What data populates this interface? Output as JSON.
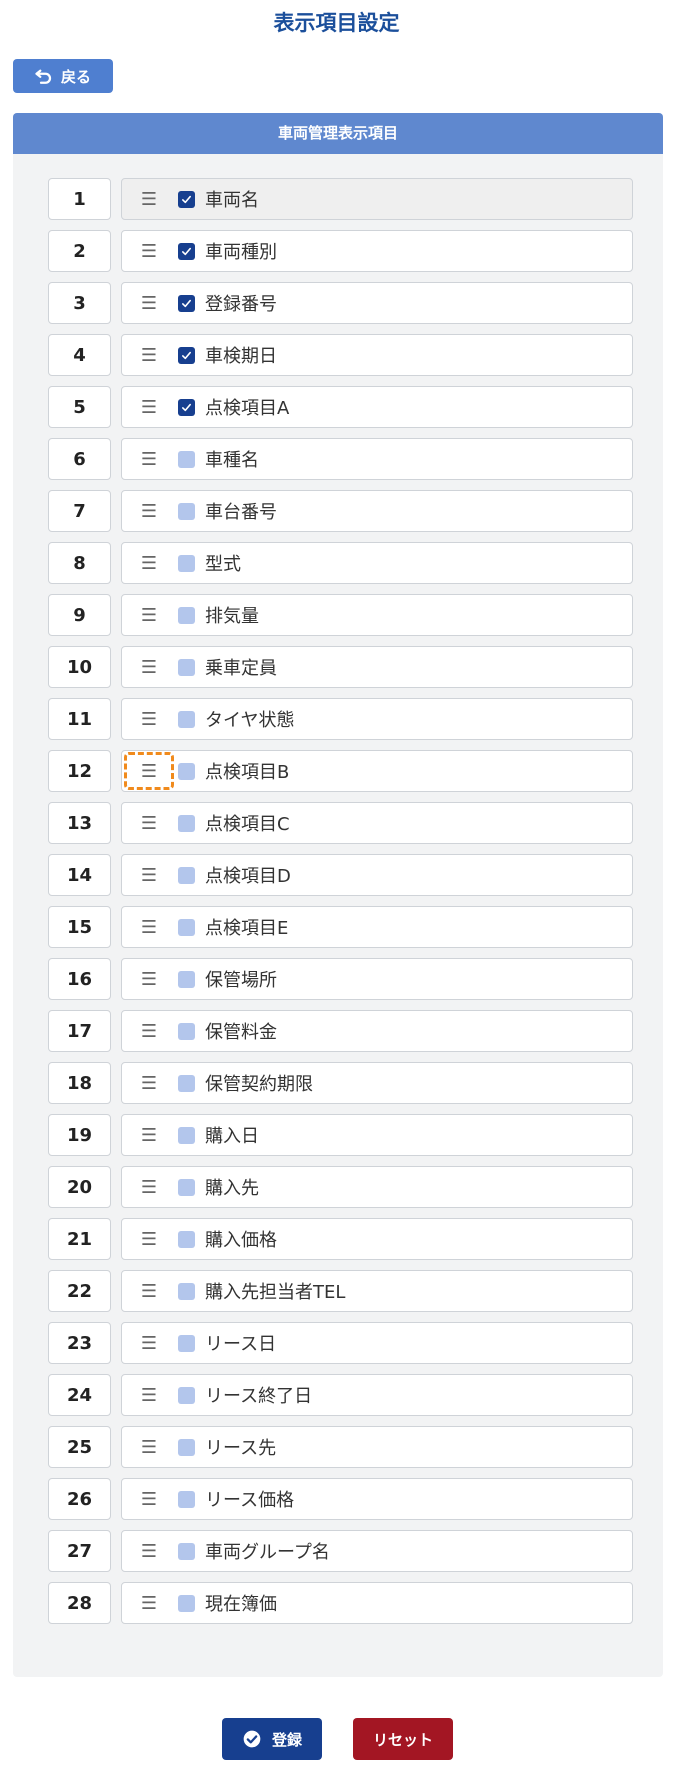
{
  "page": {
    "title": "表示項目設定"
  },
  "toolbar": {
    "back_label": "戻る"
  },
  "panel": {
    "title": "車両管理表示項目",
    "items": [
      {
        "number": "1",
        "label": "車両名",
        "checked": true
      },
      {
        "number": "2",
        "label": "車両種別",
        "checked": true
      },
      {
        "number": "3",
        "label": "登録番号",
        "checked": true
      },
      {
        "number": "4",
        "label": "車検期日",
        "checked": true
      },
      {
        "number": "5",
        "label": "点検項目A",
        "checked": true
      },
      {
        "number": "6",
        "label": "車種名",
        "checked": false
      },
      {
        "number": "7",
        "label": "車台番号",
        "checked": false
      },
      {
        "number": "8",
        "label": "型式",
        "checked": false
      },
      {
        "number": "9",
        "label": "排気量",
        "checked": false
      },
      {
        "number": "10",
        "label": "乗車定員",
        "checked": false
      },
      {
        "number": "11",
        "label": "タイヤ状態",
        "checked": false
      },
      {
        "number": "12",
        "label": "点検項目B",
        "checked": false
      },
      {
        "number": "13",
        "label": "点検項目C",
        "checked": false
      },
      {
        "number": "14",
        "label": "点検項目D",
        "checked": false
      },
      {
        "number": "15",
        "label": "点検項目E",
        "checked": false
      },
      {
        "number": "16",
        "label": "保管場所",
        "checked": false
      },
      {
        "number": "17",
        "label": "保管料金",
        "checked": false
      },
      {
        "number": "18",
        "label": "保管契約期限",
        "checked": false
      },
      {
        "number": "19",
        "label": "購入日",
        "checked": false
      },
      {
        "number": "20",
        "label": "購入先",
        "checked": false
      },
      {
        "number": "21",
        "label": "購入価格",
        "checked": false
      },
      {
        "number": "22",
        "label": "購入先担当者TEL",
        "checked": false
      },
      {
        "number": "23",
        "label": "リース日",
        "checked": false
      },
      {
        "number": "24",
        "label": "リース終了日",
        "checked": false
      },
      {
        "number": "25",
        "label": "リース先",
        "checked": false
      },
      {
        "number": "26",
        "label": "リース価格",
        "checked": false
      },
      {
        "number": "27",
        "label": "車両グループ名",
        "checked": false
      },
      {
        "number": "28",
        "label": "現在簿価",
        "checked": false
      }
    ],
    "focused_item": "12"
  },
  "footer": {
    "register_label": "登録",
    "reset_label": "リセット"
  },
  "icons": {
    "back": "return-arrow-icon",
    "handle": "drag-handle-icon",
    "check": "check-icon",
    "register": "check-circle-icon"
  },
  "colors": {
    "title": "#1b4f9b",
    "primary": "#173f8f",
    "header": "#5f88cf",
    "back": "#4f7fd0",
    "reset": "#a31623",
    "checkbox_unchecked": "#b3c6ec",
    "focus_outline": "#f08a1c"
  }
}
